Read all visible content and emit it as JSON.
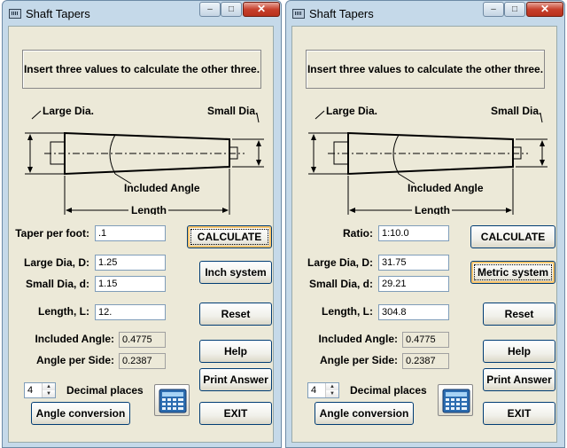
{
  "windows": [
    {
      "title": "Shaft Tapers",
      "instruction": "Insert three values to calculate the other three.",
      "diagram": {
        "large_dia": "Large Dia.",
        "small_dia": "Small Dia.",
        "included_angle": "Included Angle",
        "length": "Length"
      },
      "fields": {
        "first_label": "Taper per foot:",
        "first_value": ".1",
        "large_label": "Large Dia, D:",
        "large_value": "1.25",
        "small_label": "Small Dia, d:",
        "small_value": "1.15",
        "length_label": "Length, L:",
        "length_value": "12.",
        "angle_label": "Included Angle:",
        "angle_value": "0.4775",
        "side_label": "Angle per Side:",
        "side_value": "0.2387"
      },
      "buttons": {
        "calculate": "CALCULATE",
        "system": "Inch system",
        "reset": "Reset",
        "help": "Help",
        "print": "Print Answer",
        "exit": "EXIT",
        "angle_conv": "Angle conversion"
      },
      "decimal_places_value": "4",
      "decimal_places_label": "Decimal places"
    },
    {
      "title": "Shaft Tapers",
      "instruction": "Insert three values to calculate the other three.",
      "diagram": {
        "large_dia": "Large Dia.",
        "small_dia": "Small Dia.",
        "included_angle": "Included Angle",
        "length": "Length"
      },
      "fields": {
        "first_label": "Ratio:",
        "first_value": "1:10.0",
        "large_label": "Large Dia, D:",
        "large_value": "31.75",
        "small_label": "Small Dia, d:",
        "small_value": "29.21",
        "length_label": "Length, L:",
        "length_value": "304.8",
        "angle_label": "Included Angle:",
        "angle_value": "0.4775",
        "side_label": "Angle per Side:",
        "side_value": "0.2387"
      },
      "buttons": {
        "calculate": "CALCULATE",
        "system": "Metric system",
        "reset": "Reset",
        "help": "Help",
        "print": "Print Answer",
        "exit": "EXIT",
        "angle_conv": "Angle conversion"
      },
      "decimal_places_value": "4",
      "decimal_places_label": "Decimal places"
    }
  ],
  "title_buttons": {
    "minimize": "–",
    "maximize": "□",
    "close": "✕"
  },
  "icons": {
    "app": "calculator-window-icon",
    "calc": "calculator-icon"
  }
}
